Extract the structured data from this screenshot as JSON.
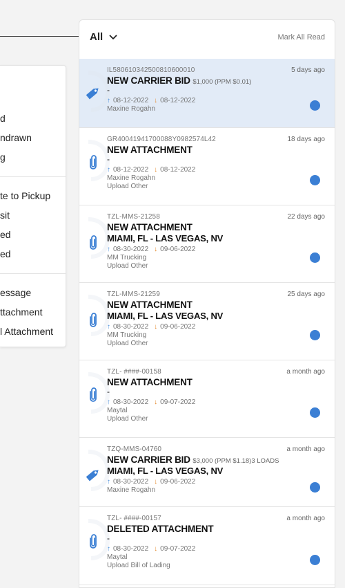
{
  "side_menu": {
    "items": [
      {
        "label": "d",
        "group": 1
      },
      {
        "label": "ndrawn",
        "group": 1
      },
      {
        "label": "g",
        "group": 1
      },
      {
        "label": "te to Pickup",
        "group": 2
      },
      {
        "label": "sit",
        "group": 2
      },
      {
        "label": "ed",
        "group": 2
      },
      {
        "label": "ed",
        "group": 2
      },
      {
        "label": "essage",
        "group": 3
      },
      {
        "label": "ttachment",
        "group": 3
      },
      {
        "label": "l Attachment",
        "group": 3
      }
    ]
  },
  "header": {
    "filter_label": "All",
    "mark_all_label": "Mark All Read"
  },
  "notifications": [
    {
      "ref": "IL580610342500810600010",
      "time": "5 days ago",
      "title": "NEW CARRIER BID",
      "extra": "$1,000 (PPM $0.01)",
      "route": "",
      "dash": "-",
      "pickup": "08-12-2022",
      "delivery": "08-12-2022",
      "user": "Maxine Rogahn",
      "sub": "",
      "icon": "tag-icon",
      "highlight": true
    },
    {
      "ref": "GR40041941700088Y0982574L42",
      "time": "18 days ago",
      "title": "NEW ATTACHMENT",
      "extra": "",
      "route": "",
      "dash": "-",
      "pickup": "08-12-2022",
      "delivery": "08-12-2022",
      "user": "Maxine Rogahn",
      "sub": "Upload Other",
      "icon": "paperclip-icon",
      "highlight": false
    },
    {
      "ref": "TZL-MMS-21258",
      "time": "22 days ago",
      "title": "NEW ATTACHMENT",
      "extra": "",
      "route": "MIAMI, FL - LAS VEGAS, NV",
      "dash": "",
      "pickup": "08-30-2022",
      "delivery": "09-06-2022",
      "user": "MM Trucking",
      "sub": "Upload Other",
      "icon": "paperclip-icon",
      "highlight": false
    },
    {
      "ref": "TZL-MMS-21259",
      "time": "25 days ago",
      "title": "NEW ATTACHMENT",
      "extra": "",
      "route": "MIAMI, FL - LAS VEGAS, NV",
      "dash": "",
      "pickup": "08-30-2022",
      "delivery": "09-06-2022",
      "user": "MM Trucking",
      "sub": "Upload Other",
      "icon": "paperclip-icon",
      "highlight": false
    },
    {
      "ref": "TZL- ####-00158",
      "time": "a month ago",
      "title": "NEW ATTACHMENT",
      "extra": "",
      "route": "",
      "dash": "-",
      "pickup": "08-30-2022",
      "delivery": "09-07-2022",
      "user": "Maytal",
      "sub": "Upload Other",
      "icon": "paperclip-icon",
      "highlight": false
    },
    {
      "ref": "TZQ-MMS-04760",
      "time": "a month ago",
      "title": "NEW CARRIER BID",
      "extra": "$3,000 (PPM $1.18)3 LOADS",
      "route": "MIAMI, FL - LAS VEGAS, NV",
      "dash": "",
      "pickup": "08-30-2022",
      "delivery": "09-06-2022",
      "user": "Maxine Rogahn",
      "sub": "",
      "icon": "tag-icon",
      "highlight": false
    },
    {
      "ref": "TZL- ####-00157",
      "time": "a month ago",
      "title": "DELETED ATTACHMENT",
      "extra": "",
      "route": "",
      "dash": "-",
      "pickup": "08-30-2022",
      "delivery": "09-07-2022",
      "user": "Maytal",
      "sub": "Upload Bill of Lading",
      "icon": "paperclip-icon",
      "highlight": false
    }
  ],
  "colors": {
    "accent": "#3b7fd4",
    "highlight": "#e2ebf7",
    "pickup_arrow": "#4a8fdc",
    "delivery_arrow": "#e5892c"
  }
}
